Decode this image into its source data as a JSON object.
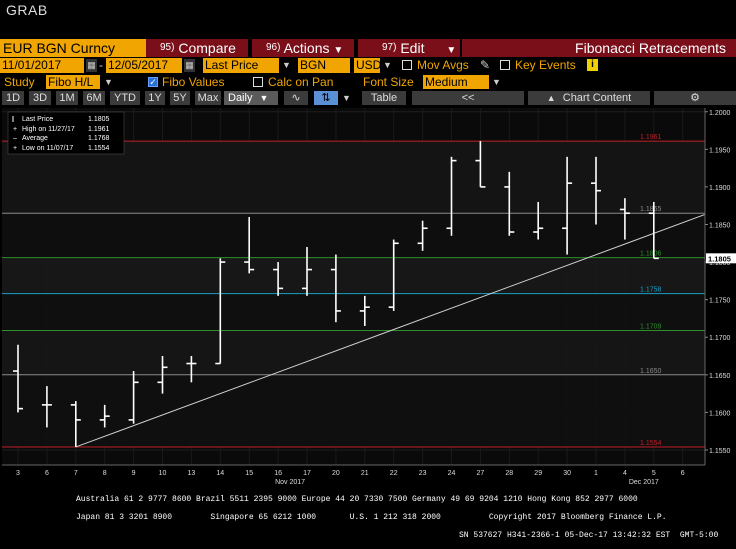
{
  "window_title": "GRAB",
  "toolbar": {
    "security": "EUR BGN Curncy",
    "compare_num": "95)",
    "compare_label": "Compare",
    "actions_num": "96)",
    "actions_label": "Actions",
    "edit_num": "97)",
    "edit_label": "Edit",
    "panel_title": "Fibonacci Retracements"
  },
  "settings": {
    "start_date": "11/01/2017",
    "end_date": "12/05/2017",
    "price_field": "Last Price",
    "source": "BGN",
    "currency": "USD",
    "mov_avgs_label": "Mov Avgs",
    "mov_avgs_checked": false,
    "key_events_label": "Key Events",
    "key_events_badge": "i"
  },
  "study_row": {
    "study_label": "Study",
    "study_value": "Fibo H/L",
    "fibo_values_label": "Fibo Values",
    "fibo_values_checked": true,
    "calc_on_pan_label": "Calc on Pan",
    "calc_on_pan_checked": false,
    "font_size_label": "Font Size",
    "font_size_value": "Medium"
  },
  "range_row": {
    "buttons": [
      "1D",
      "3D",
      "1M",
      "6M",
      "YTD",
      "1Y",
      "5Y",
      "Max"
    ],
    "period": "Daily",
    "table_label": "Table",
    "nav_left": "<<",
    "chart_content_label": "Chart Content"
  },
  "legend": {
    "last_price_label": "Last Price",
    "last_price_value": "1.1805",
    "high_label": "High on 11/27/17",
    "high_value": "1.1961",
    "average_label": "Average",
    "average_value": "1.1768",
    "low_label": "Low on 11/07/17",
    "low_value": "1.1554"
  },
  "colors": {
    "amber": "#f0a500",
    "toolbar_red": "#7a0f1a",
    "fib_red": "#c0202a",
    "fib_green": "#2d8f2d",
    "fib_cyan": "#1aa0c8",
    "fib_grey": "#8a8a8a"
  },
  "chart_data": {
    "type": "ohlc",
    "ylim": [
      1.153,
      1.2005
    ],
    "y_ticks": [
      "1.2000",
      "1.1950",
      "1.1900",
      "1.1850",
      "1.1800",
      "1.1750",
      "1.1700",
      "1.1650",
      "1.1600",
      "1.1550"
    ],
    "x_tick_labels": [
      "3",
      "6",
      "7",
      "8",
      "9",
      "10",
      "13",
      "14",
      "15",
      "16",
      "17",
      "20",
      "21",
      "22",
      "23",
      "24",
      "27",
      "28",
      "29",
      "30",
      "1",
      "4",
      "5",
      "6"
    ],
    "month_labels": [
      "Nov 2017",
      "Dec 2017"
    ],
    "bars": [
      {
        "date": "11/03",
        "open": 1.1655,
        "high": 1.169,
        "low": 1.16,
        "close": 1.1605
      },
      {
        "date": "11/06",
        "open": 1.161,
        "high": 1.1635,
        "low": 1.158,
        "close": 1.161
      },
      {
        "date": "11/07",
        "open": 1.161,
        "high": 1.1615,
        "low": 1.1554,
        "close": 1.159
      },
      {
        "date": "11/08",
        "open": 1.159,
        "high": 1.161,
        "low": 1.158,
        "close": 1.1595
      },
      {
        "date": "11/09",
        "open": 1.159,
        "high": 1.1655,
        "low": 1.1585,
        "close": 1.164
      },
      {
        "date": "11/10",
        "open": 1.164,
        "high": 1.1675,
        "low": 1.1625,
        "close": 1.166
      },
      {
        "date": "11/13",
        "open": 1.1665,
        "high": 1.1675,
        "low": 1.164,
        "close": 1.1665
      },
      {
        "date": "11/14",
        "open": 1.1665,
        "high": 1.1805,
        "low": 1.1665,
        "close": 1.18
      },
      {
        "date": "11/15",
        "open": 1.18,
        "high": 1.186,
        "low": 1.1785,
        "close": 1.179
      },
      {
        "date": "11/16",
        "open": 1.179,
        "high": 1.18,
        "low": 1.1755,
        "close": 1.1765
      },
      {
        "date": "11/17",
        "open": 1.1765,
        "high": 1.182,
        "low": 1.1755,
        "close": 1.179
      },
      {
        "date": "11/20",
        "open": 1.179,
        "high": 1.181,
        "low": 1.172,
        "close": 1.1735
      },
      {
        "date": "11/21",
        "open": 1.1735,
        "high": 1.1755,
        "low": 1.1715,
        "close": 1.174
      },
      {
        "date": "11/22",
        "open": 1.174,
        "high": 1.183,
        "low": 1.1735,
        "close": 1.1825
      },
      {
        "date": "11/23",
        "open": 1.1825,
        "high": 1.1855,
        "low": 1.1815,
        "close": 1.1845
      },
      {
        "date": "11/24",
        "open": 1.1845,
        "high": 1.194,
        "low": 1.1835,
        "close": 1.1935
      },
      {
        "date": "11/27",
        "open": 1.1935,
        "high": 1.1961,
        "low": 1.19,
        "close": 1.19
      },
      {
        "date": "11/28",
        "open": 1.19,
        "high": 1.192,
        "low": 1.1835,
        "close": 1.184
      },
      {
        "date": "11/29",
        "open": 1.184,
        "high": 1.188,
        "low": 1.183,
        "close": 1.1845
      },
      {
        "date": "11/30",
        "open": 1.1845,
        "high": 1.194,
        "low": 1.181,
        "close": 1.1905
      },
      {
        "date": "12/01",
        "open": 1.1905,
        "high": 1.194,
        "low": 1.185,
        "close": 1.1895
      },
      {
        "date": "12/04",
        "open": 1.187,
        "high": 1.1885,
        "low": 1.183,
        "close": 1.1865
      },
      {
        "date": "12/05",
        "open": 1.1865,
        "high": 1.188,
        "low": 1.1805,
        "close": 1.1805
      }
    ],
    "fib_levels": [
      {
        "label": "1.1961",
        "value": 1.1961,
        "color": "#c0202a"
      },
      {
        "label": "1.1865",
        "value": 1.1865,
        "color": "#8a8a8a"
      },
      {
        "label": "1.1806",
        "value": 1.1806,
        "color": "#2d8f2d"
      },
      {
        "label": "1.1758",
        "value": 1.1758,
        "color": "#1aa0c8"
      },
      {
        "label": "1.1709",
        "value": 1.1709,
        "color": "#2d8f2d"
      },
      {
        "label": "1.1650",
        "value": 1.165,
        "color": "#8a8a8a"
      },
      {
        "label": "1.1554",
        "value": 1.1554,
        "color": "#c0202a"
      }
    ],
    "trendline": {
      "x_start_index": 2,
      "y_start": 1.1554,
      "x_end_index": 24.8,
      "y_end": 1.1878
    },
    "last_price_tag": "1.1805",
    "grid": true
  },
  "footer": {
    "line1": "Australia 61 2 9777 8600 Brazil 5511 2395 9000 Europe 44 20 7330 7500 Germany 49 69 9204 1210 Hong Kong 852 2977 6000",
    "line2": "Japan 81 3 3201 8900        Singapore 65 6212 1000       U.S. 1 212 318 2000          Copyright 2017 Bloomberg Finance L.P.",
    "line3": "SN 537627 H341-2366-1 05-Dec-17 13:42:32 EST  GMT-5:00"
  }
}
